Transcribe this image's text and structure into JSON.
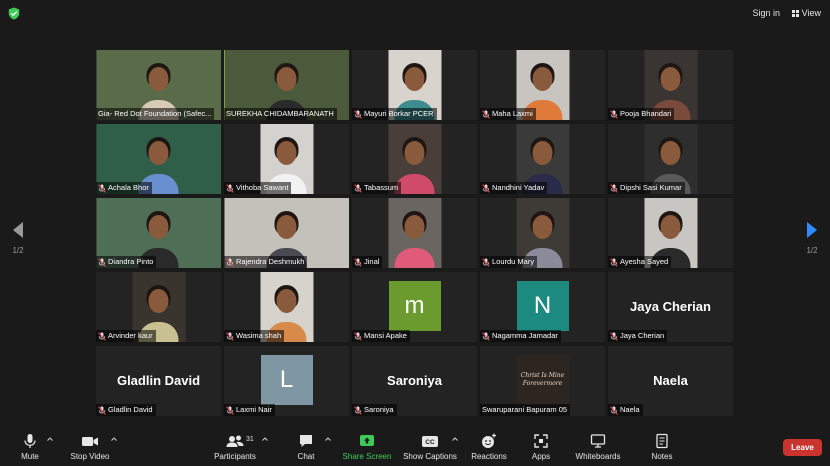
{
  "topbar": {
    "signin_label": "Sign in",
    "view_label": "View",
    "security_icon": "shield-check-icon"
  },
  "pager": {
    "left_page": "1/2",
    "right_page": "1/2"
  },
  "colors": {
    "active_speaker": "#c6e152",
    "share_green": "#3fcb5a",
    "leave_red": "#c9342f",
    "avatar_green": "#6b9a2e",
    "avatar_teal": "#1d8a80",
    "avatar_slate": "#7f97a2"
  },
  "participants": [
    {
      "name": "Gia- Red Dot Foundation (Safec...",
      "muted": false,
      "video": true,
      "active": false
    },
    {
      "name": "SUREKHA CHIDAMBARANATH",
      "muted": false,
      "video": true,
      "active": true
    },
    {
      "name": "Mayuri Borkar PCER",
      "muted": true,
      "video": true,
      "active": false
    },
    {
      "name": "Maha Laxmi",
      "muted": true,
      "video": true,
      "active": false
    },
    {
      "name": "Pooja Bhandari",
      "muted": true,
      "video": true,
      "active": false
    },
    {
      "name": "Achala Bhor",
      "muted": true,
      "video": true,
      "active": false
    },
    {
      "name": "Vithoba Sawant",
      "muted": true,
      "video": true,
      "active": false
    },
    {
      "name": "Tabassum",
      "muted": true,
      "video": true,
      "active": false
    },
    {
      "name": "Nandhini Yadav",
      "muted": true,
      "video": true,
      "active": false
    },
    {
      "name": "Dipshi Sasi Kumar",
      "muted": true,
      "video": true,
      "active": false
    },
    {
      "name": "Diandra Pinto",
      "muted": true,
      "video": true,
      "active": false
    },
    {
      "name": "Rajendra Deshmukh",
      "muted": true,
      "video": true,
      "active": false
    },
    {
      "name": "Jinal",
      "muted": true,
      "video": true,
      "active": false
    },
    {
      "name": "Lourdu Mary",
      "muted": true,
      "video": true,
      "active": false
    },
    {
      "name": "Ayesha Sayed",
      "muted": true,
      "video": true,
      "active": false
    },
    {
      "name": "Arvinder kaur",
      "muted": true,
      "video": true,
      "active": false
    },
    {
      "name": "Wasima shah",
      "muted": true,
      "video": true,
      "active": false
    },
    {
      "name": "Mansi Apake",
      "muted": true,
      "video": false,
      "avatar_letter": "m",
      "avatar_color": "#6b9a2e"
    },
    {
      "name": "Nagamma Jamadar",
      "muted": true,
      "video": false,
      "avatar_letter": "N",
      "avatar_color": "#1d8a80"
    },
    {
      "name": "Jaya Cherian",
      "muted": true,
      "video": false,
      "display_name": "Jaya Cherian"
    },
    {
      "name": "Gladlin David",
      "muted": true,
      "video": false,
      "display_name": "Gladlin David"
    },
    {
      "name": "Laxmi Nair",
      "muted": true,
      "video": false,
      "avatar_letter": "L",
      "avatar_color": "#7f97a2"
    },
    {
      "name": "Saroniya",
      "muted": true,
      "video": false,
      "display_name": "Saroniya"
    },
    {
      "name": "Swaruparani Bapuram 05",
      "muted": false,
      "video": false,
      "logo_text": "Christ Is Mine Forevermore"
    },
    {
      "name": "Naela",
      "muted": true,
      "video": false,
      "display_name": "Naela"
    }
  ],
  "toolbar": {
    "mute_label": "Mute",
    "stop_video_label": "Stop Video",
    "participants_label": "Participants",
    "participants_count": "31",
    "chat_label": "Chat",
    "share_screen_label": "Share Screen",
    "show_captions_label": "Show Captions",
    "reactions_label": "Reactions",
    "apps_label": "Apps",
    "whiteboards_label": "Whiteboards",
    "notes_label": "Notes",
    "leave_label": "Leave"
  }
}
